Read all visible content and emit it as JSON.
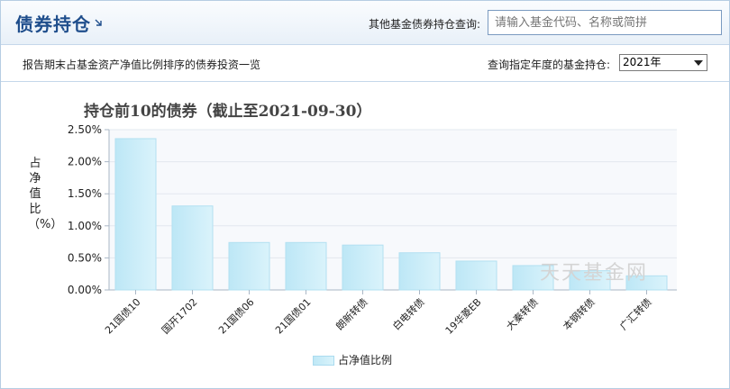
{
  "header": {
    "title": "债券持仓",
    "search_label": "其他基金债券持仓查询:",
    "search_placeholder": "请输入基金代码、名称或简拼"
  },
  "subheader": {
    "description": "报告期末占基金资产净值比例排序的债券投资一览",
    "year_label": "查询指定年度的基金持仓:",
    "year_value": "2021年"
  },
  "watermark": "天天基金网",
  "colors": {
    "bar": "#c6ecf8",
    "title": "#1f4e8c",
    "border": "#b6cde3"
  },
  "chart_data": {
    "type": "bar",
    "title": "持仓前10的债券（截止至2021-09-30）",
    "ylabel": "占净值比（%）",
    "xlabel": "",
    "ylim": [
      0,
      2.5
    ],
    "yticks": [
      "0.00%",
      "0.50%",
      "1.00%",
      "1.50%",
      "2.00%",
      "2.50%"
    ],
    "categories": [
      "21国债10",
      "国开1702",
      "21国债06",
      "21国债01",
      "朗新转债",
      "白电转债",
      "19华菱EB",
      "大秦转债",
      "本钢转债",
      "广汇转债"
    ],
    "series": [
      {
        "name": "占净值比例",
        "values": [
          2.36,
          1.31,
          0.74,
          0.74,
          0.7,
          0.58,
          0.45,
          0.38,
          0.3,
          0.22
        ]
      }
    ],
    "grid": true,
    "legend": "bottom"
  }
}
